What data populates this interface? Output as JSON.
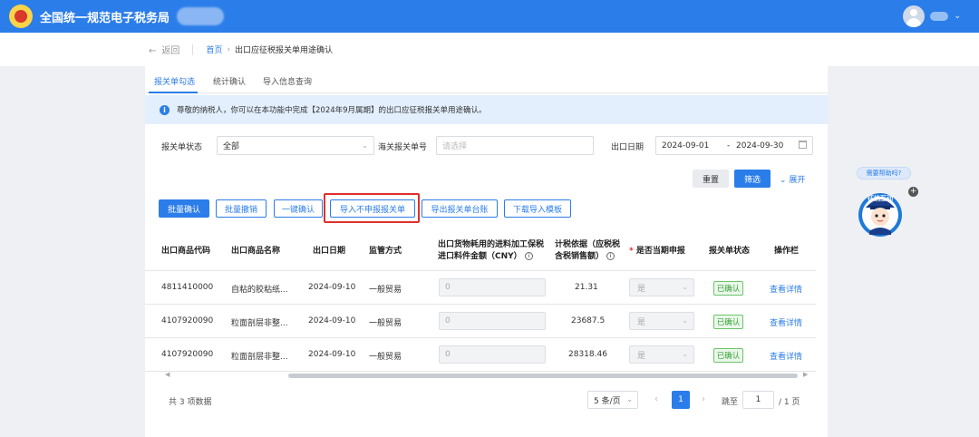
{
  "header": {
    "app_title": "全国统一规范电子税务局"
  },
  "breadcrumb": {
    "back": "返回",
    "home": "首页",
    "current": "出口应征税报关单用途确认"
  },
  "tabs": [
    {
      "label": "报关单勾选"
    },
    {
      "label": "统计确认"
    },
    {
      "label": "导入信息查询"
    }
  ],
  "notice": {
    "text": "尊敬的纳税人，你可以在本功能中完成【2024年9月属期】的出口应征税报关单用途确认。"
  },
  "filters": {
    "status_label": "报关单状态",
    "status_value": "全部",
    "customs_no_label": "海关报关单号",
    "customs_no_placeholder": "请选择",
    "export_date_label": "出口日期",
    "date_start": "2024-09-01",
    "date_sep": "-",
    "date_end": "2024-09-30",
    "reset": "重置",
    "filter": "筛选",
    "expand": "展开"
  },
  "actions": {
    "batch_confirm": "批量确认",
    "batch_revoke": "批量撤销",
    "one_click_confirm": "一键确认",
    "import_unreported": "导入不申报报关单",
    "export_ledger": "导出报关单台账",
    "download_template": "下载导入模板"
  },
  "table": {
    "columns": {
      "code": "出口商品代码",
      "name": "出口商品名称",
      "date": "出口日期",
      "method": "监管方式",
      "amount_l1": "出口货物耗用的进料加工保税",
      "amount_l2": "进口料件金额（CNY）",
      "basis_l1": "计税依据（应税税",
      "basis_l2": "含税销售额）",
      "declare": "是否当期申报",
      "status": "报关单状态",
      "op": "操作栏"
    },
    "rows": [
      {
        "code": "4811410000",
        "name": "自粘的胶粘纸...",
        "date": "2024-09-10",
        "method": "一般贸易",
        "amount": "0",
        "basis": "21.31",
        "declare": "是",
        "status": "已确认",
        "op": "查看详情"
      },
      {
        "code": "4107920090",
        "name": "粒面剖层非整...",
        "date": "2024-09-10",
        "method": "一般贸易",
        "amount": "0",
        "basis": "23687.5",
        "declare": "是",
        "status": "已确认",
        "op": "查看详情"
      },
      {
        "code": "4107920090",
        "name": "粒面剖层非整...",
        "date": "2024-09-10",
        "method": "一般贸易",
        "amount": "0",
        "basis": "28318.46",
        "declare": "是",
        "status": "已确认",
        "op": "查看详情"
      }
    ]
  },
  "pagination": {
    "total": "共 3 项数据",
    "page_size": "5 条/页",
    "current": "1",
    "goto_label": "跳至",
    "goto_value": "1",
    "of_pages": "/ 1 页"
  },
  "assistant": {
    "bubble": "需要帮助吗?",
    "badge": "征纳互动"
  },
  "colors": {
    "primary": "#2b7de9",
    "highlight": "#e0302d",
    "success": "#3aa23a"
  }
}
